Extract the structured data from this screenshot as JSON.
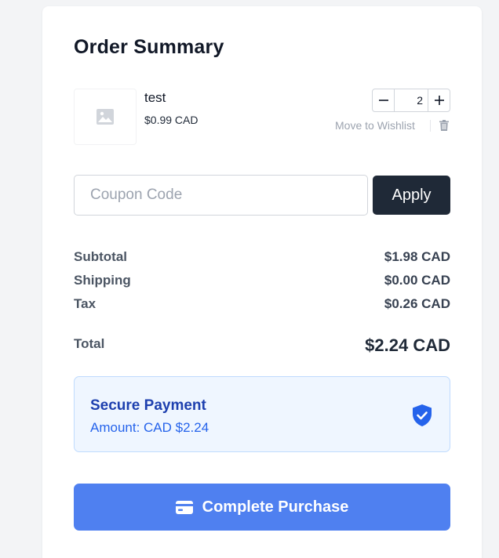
{
  "summary": {
    "title": "Order Summary"
  },
  "item": {
    "name": "test",
    "price": "$0.99 CAD",
    "quantity": "2",
    "image_icon": "image-placeholder-icon",
    "move_to_wishlist": "Move to Wishlist",
    "remove_icon": "trash-icon"
  },
  "coupon": {
    "placeholder": "Coupon Code",
    "value": "",
    "apply_label": "Apply"
  },
  "totals": {
    "subtotal_label": "Subtotal",
    "subtotal_value": "$1.98 CAD",
    "shipping_label": "Shipping",
    "shipping_value": "$0.00 CAD",
    "tax_label": "Tax",
    "tax_value": "$0.26 CAD",
    "total_label": "Total",
    "total_value": "$2.24 CAD"
  },
  "secure_payment": {
    "title": "Secure Payment",
    "amount": "Amount: CAD $2.24",
    "icon": "shield-check-icon"
  },
  "purchase": {
    "label": "Complete Purchase",
    "icon": "credit-card-icon"
  },
  "colors": {
    "primary": "#4f80f0",
    "dark_button": "#1f2937",
    "secure_bg": "#eff6ff",
    "secure_text": "#1e40af",
    "shield": "#2563eb"
  }
}
